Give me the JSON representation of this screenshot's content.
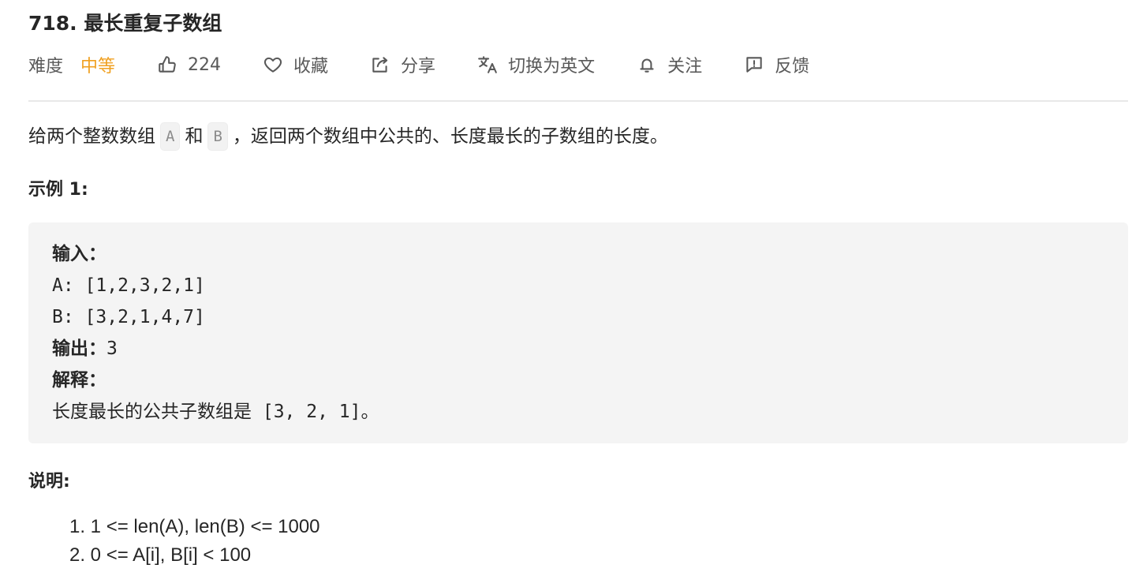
{
  "problem": {
    "title": "718. 最长重复子数组",
    "difficulty_label": "难度",
    "difficulty_value": "中等"
  },
  "actions": {
    "like_count": "224",
    "favorite": "收藏",
    "share": "分享",
    "switch_language": "切换为英文",
    "follow": "关注",
    "feedback": "反馈"
  },
  "icons": {
    "like": "thumbs-up-icon",
    "favorite": "heart-icon",
    "share": "share-icon",
    "translate": "translate-icon",
    "follow": "bell-icon",
    "feedback": "feedback-icon"
  },
  "colors": {
    "difficulty_medium": "#f0a020",
    "example_background": "#f4f4f4"
  },
  "description": {
    "prefix": "给两个整数数组",
    "var_a": "A",
    "conj": "和",
    "var_b": "B",
    "suffix": "，返回两个数组中公共的、长度最长的子数组的长度。"
  },
  "example": {
    "heading": "示例 1:",
    "input_label": "输入：",
    "line_a": "A: [1,2,3,2,1]",
    "line_b": "B: [3,2,1,4,7]",
    "output_label": "输出：",
    "output_value": "3",
    "explain_label": "解释：",
    "explain_text": "长度最长的公共子数组是 [3, 2, 1]。"
  },
  "notes": {
    "heading": "说明:",
    "items": [
      "1. 1 <= len(A), len(B) <= 1000",
      "2. 0 <= A[i], B[i] < 100"
    ]
  }
}
